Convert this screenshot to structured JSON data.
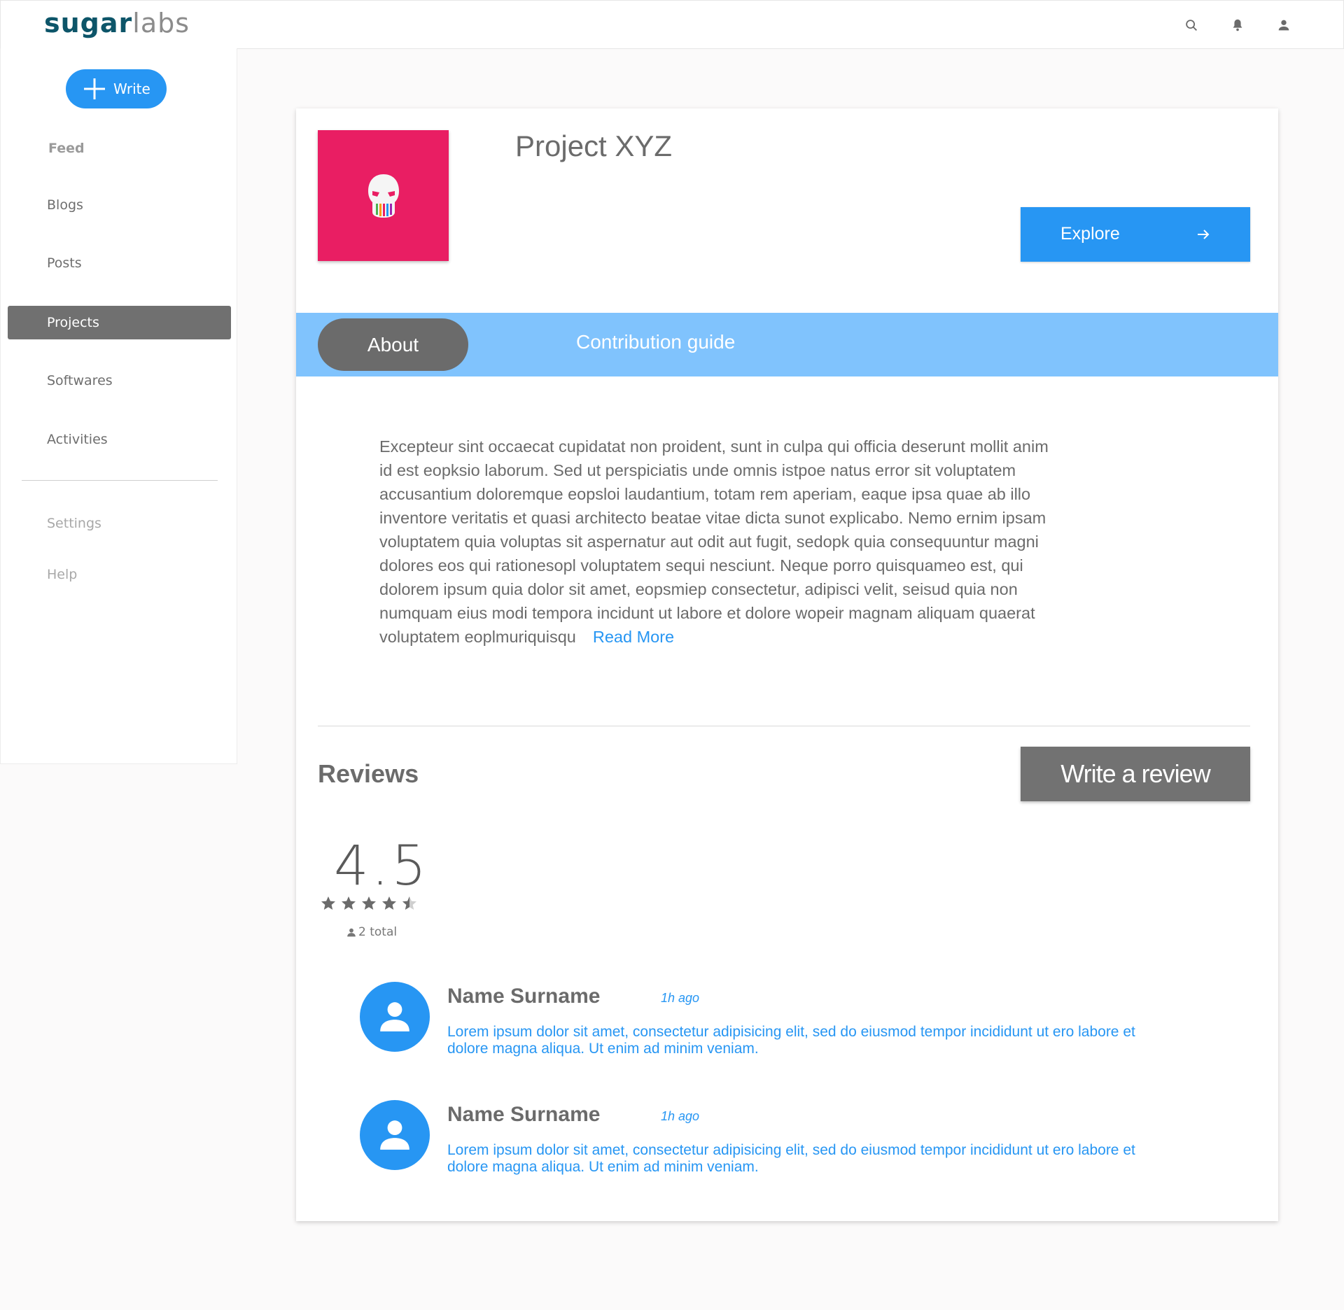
{
  "header": {
    "logo_bold": "sugar",
    "logo_light": "labs",
    "icons": [
      "search-icon",
      "bell-icon",
      "user-icon"
    ]
  },
  "sidebar": {
    "write_label": "Write",
    "items": [
      {
        "label": "Feed"
      },
      {
        "label": "Blogs"
      },
      {
        "label": "Posts"
      },
      {
        "label": "Projects",
        "active": true
      },
      {
        "label": "Softwares"
      },
      {
        "label": "Activities"
      }
    ],
    "secondary": [
      {
        "label": "Settings"
      },
      {
        "label": "Help"
      }
    ]
  },
  "project": {
    "title": "Project XYZ",
    "explore_label": "Explore",
    "tabs": [
      {
        "label": "About",
        "active": true
      },
      {
        "label": "Contribution guide"
      }
    ],
    "about_text": "Excepteur sint occaecat cupidatat non proident, sunt in culpa qui officia deserunt mollit anim id est eopksio laborum. Sed ut perspiciatis unde omnis istpoe natus error sit voluptatem accusantium doloremque eopsloi laudantium, totam rem aperiam, eaque ipsa quae ab illo inventore veritatis et quasi architecto beatae vitae dicta sunot explicabo. Nemo ernim ipsam voluptatem quia voluptas sit aspernatur aut odit aut fugit, sedopk quia consequuntur magni dolores eos qui rationesopl voluptatem sequi nesciunt. Neque porro quisquameo est, qui dolorem ipsum quia dolor sit amet, eopsmiep consectetur, adipisci velit, seisud quia non numquam eius modi tempora incidunt ut labore et dolore wopeir magnam aliquam quaerat voluptatem eoplmuriquisqu",
    "read_more": "Read More"
  },
  "reviews": {
    "title": "Reviews",
    "write_label": "Write a review",
    "rating": "4.5",
    "rating_value": 4.5,
    "total": "2 total",
    "items": [
      {
        "name": "Name Surname",
        "time": "1h ago",
        "text": "Lorem ipsum dolor sit amet, consectetur adipisicing elit, sed do eiusmod tempor incididunt ut ero labore et dolore magna aliqua. Ut enim ad minim veniam."
      },
      {
        "name": "Name Surname",
        "time": "1h ago",
        "text": "Lorem ipsum dolor sit amet, consectetur adipisicing elit, sed do eiusmod tempor incididunt ut ero labore et dolore magna aliqua. Ut enim ad minim veniam."
      }
    ]
  },
  "colors": {
    "accent": "#2796f3",
    "tabbar": "#80c3fd",
    "project_image": "#e91e63",
    "active_nav": "#707070"
  }
}
